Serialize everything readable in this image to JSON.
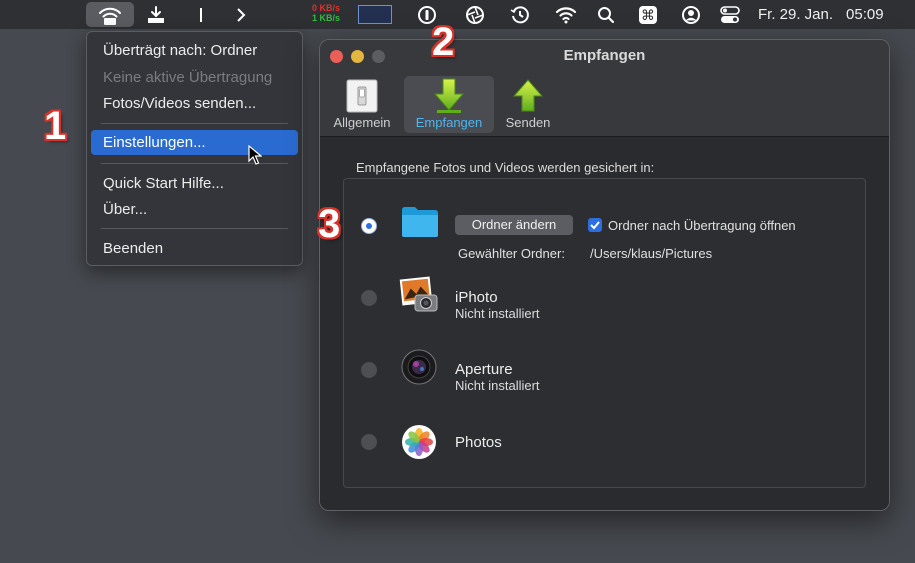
{
  "menubar": {
    "icons": [
      "wifi-share-icon",
      "download-tray-icon",
      "bar-icon",
      "chevron-right-icon",
      "display-icon",
      "info-circle-icon",
      "aperture-icon",
      "time-machine-icon",
      "wifi-icon",
      "search-icon",
      "command-icon",
      "user-icon",
      "control-center-icon"
    ],
    "net_up": "0 KB/s",
    "net_down": "1 KB/s",
    "date": "Fr. 29. Jan.",
    "time": "05:09"
  },
  "menu": {
    "item_transfer_target": "Überträgt nach: Ordner",
    "item_no_transfer": "Keine aktive Übertragung",
    "item_send": "Fotos/Videos senden...",
    "item_settings": "Einstellungen...",
    "item_quickstart": "Quick Start Hilfe...",
    "item_about": "Über...",
    "item_quit": "Beenden"
  },
  "window": {
    "title": "Empfangen",
    "toolbar": {
      "general": "Allgemein",
      "receive": "Empfangen",
      "send": "Senden"
    },
    "intro": "Empfangene Fotos und Videos werden gesichert in:",
    "folder": {
      "change_button": "Ordner ändern",
      "open_after_label": "Ordner nach Übertragung öffnen",
      "open_after_checked": true,
      "selected_label": "Gewählter Ordner:",
      "selected_path": "/Users/klaus/Pictures"
    },
    "iphoto": {
      "title": "iPhoto",
      "status": "Nicht installiert"
    },
    "aperture": {
      "title": "Aperture",
      "status": "Nicht installiert"
    },
    "photos": {
      "title": "Photos"
    }
  },
  "callouts": {
    "one": "1",
    "two": "2",
    "three": "3"
  },
  "colors": {
    "accent": "#2d6fe0",
    "selected_tab_text": "#4fb4f0",
    "callout_outline": "#d8322a"
  }
}
